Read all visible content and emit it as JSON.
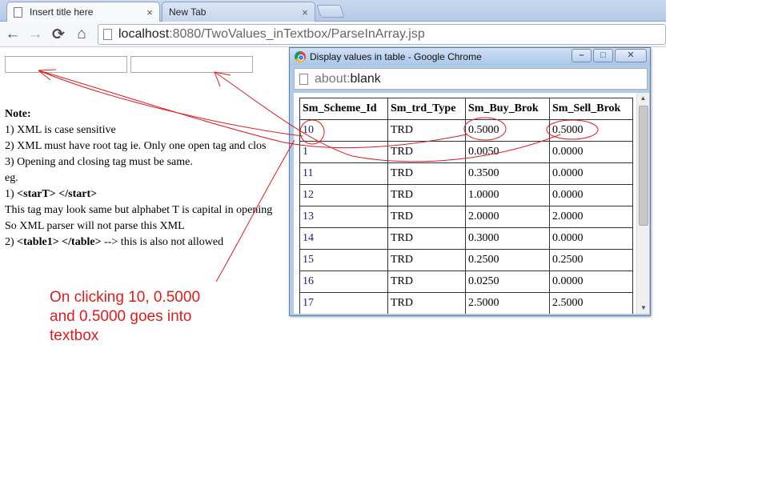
{
  "browser": {
    "tabs": [
      {
        "title": "Insert title here",
        "close": "×"
      },
      {
        "title": "New Tab",
        "close": "×"
      }
    ],
    "url_host": "localhost",
    "url_path": ":8080/TwoValues_inTextbox/ParseInArray.jsp",
    "nav": {
      "back": "←",
      "forward": "→",
      "reload": "⟳",
      "home": "⌂"
    }
  },
  "page": {
    "note_title": "Note:",
    "notes": [
      {
        "text": "1) XML is case sensitive"
      },
      {
        "text": "2) XML must have root tag ie. Only one open tag and clos"
      },
      {
        "text": "3) Opening and closing tag must be same."
      },
      {
        "text": "eg."
      },
      {
        "prefix": "1) ",
        "bold": "<starT> </start>",
        "suffix": ""
      },
      {
        "text": "This tag may look same but alphabet T is capital in opening"
      },
      {
        "text": "So XML parser will not parse this XML"
      },
      {
        "prefix": "2) ",
        "bold": "<table1> </table>",
        "suffix": " --> this is also not allowed"
      }
    ]
  },
  "popup": {
    "title": "Display values in table - Google Chrome",
    "buttons": {
      "minimize": "–",
      "maximize": "□",
      "close": "✕"
    },
    "addr_scheme": "about:",
    "addr_rest": "blank",
    "table": {
      "headers": [
        "Sm_Scheme_Id",
        "Sm_trd_Type",
        "Sm_Buy_Brok",
        "Sm_Sell_Brok"
      ],
      "rows": [
        [
          "10",
          "TRD",
          "0.5000",
          "0.5000"
        ],
        [
          "1",
          "TRD",
          "0.0050",
          "0.0000"
        ],
        [
          "11",
          "TRD",
          "0.3500",
          "0.0000"
        ],
        [
          "12",
          "TRD",
          "1.0000",
          "0.0000"
        ],
        [
          "13",
          "TRD",
          "2.0000",
          "2.0000"
        ],
        [
          "14",
          "TRD",
          "0.3000",
          "0.0000"
        ],
        [
          "15",
          "TRD",
          "0.2500",
          "0.2500"
        ],
        [
          "16",
          "TRD",
          "0.0250",
          "0.0000"
        ],
        [
          "17",
          "TRD",
          "2.5000",
          "2.5000"
        ]
      ]
    }
  },
  "annotation": {
    "caption": "On clicking 10, 0.5000\nand 0.5000 goes  into\ntextbox",
    "color": "#e11a1a"
  }
}
